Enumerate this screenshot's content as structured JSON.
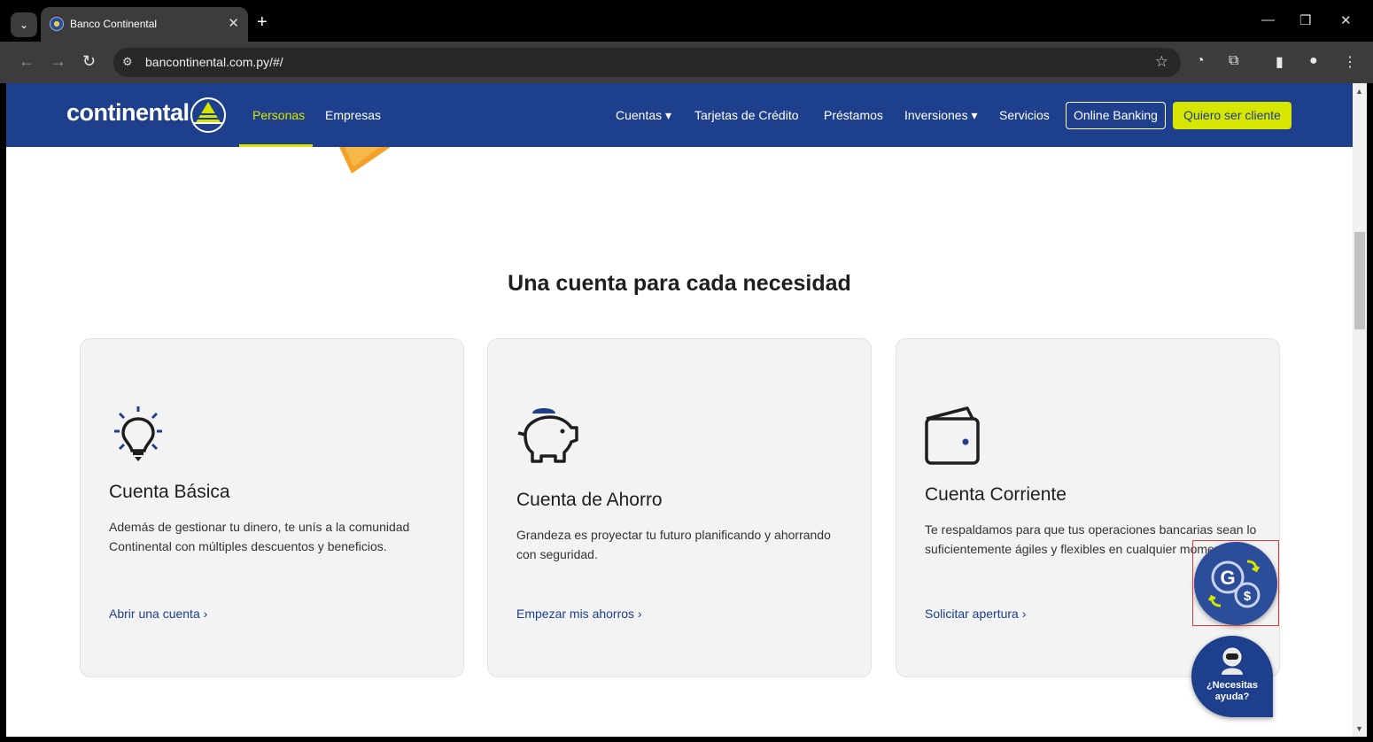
{
  "browser": {
    "tab_title": "Banco Continental",
    "url": "bancontinental.com.py/#/"
  },
  "header": {
    "logo": "continental",
    "nav_personas": "Personas",
    "nav_empresas": "Empresas",
    "nav_cuentas": "Cuentas ▾",
    "nav_tarjetas": "Tarjetas de Crédito",
    "nav_prestamos": "Préstamos",
    "nav_inversiones": "Inversiones ▾",
    "nav_servicios": "Servicios",
    "online_banking": "Online Banking",
    "quiero_cliente": "Quiero ser cliente",
    "brand_blue": "#1d3f8c",
    "accent_lime": "#d7e600"
  },
  "main": {
    "section_title": "Una cuenta para cada necesidad",
    "cards": [
      {
        "icon": "lightbulb-icon",
        "title": "Cuenta Básica",
        "description": "Además de gestionar tu dinero, te unís a la comunidad Continental con múltiples descuentos y beneficios.",
        "link": "Abrir una cuenta"
      },
      {
        "icon": "piggy-bank-icon",
        "title": "Cuenta de Ahorro",
        "description": "Grandeza es proyectar tu futuro planificando y ahorrando con seguridad.",
        "link": "Empezar mis ahorros"
      },
      {
        "icon": "wallet-icon",
        "title": "Cuenta Corriente",
        "description": "Te respaldamos para que tus operaciones bancarias sean lo suficientemente ágiles y flexibles en cualquier momento.",
        "link": "Solicitar apertura"
      }
    ]
  },
  "floating": {
    "help_label": "¿Necesitas ayuda?"
  }
}
